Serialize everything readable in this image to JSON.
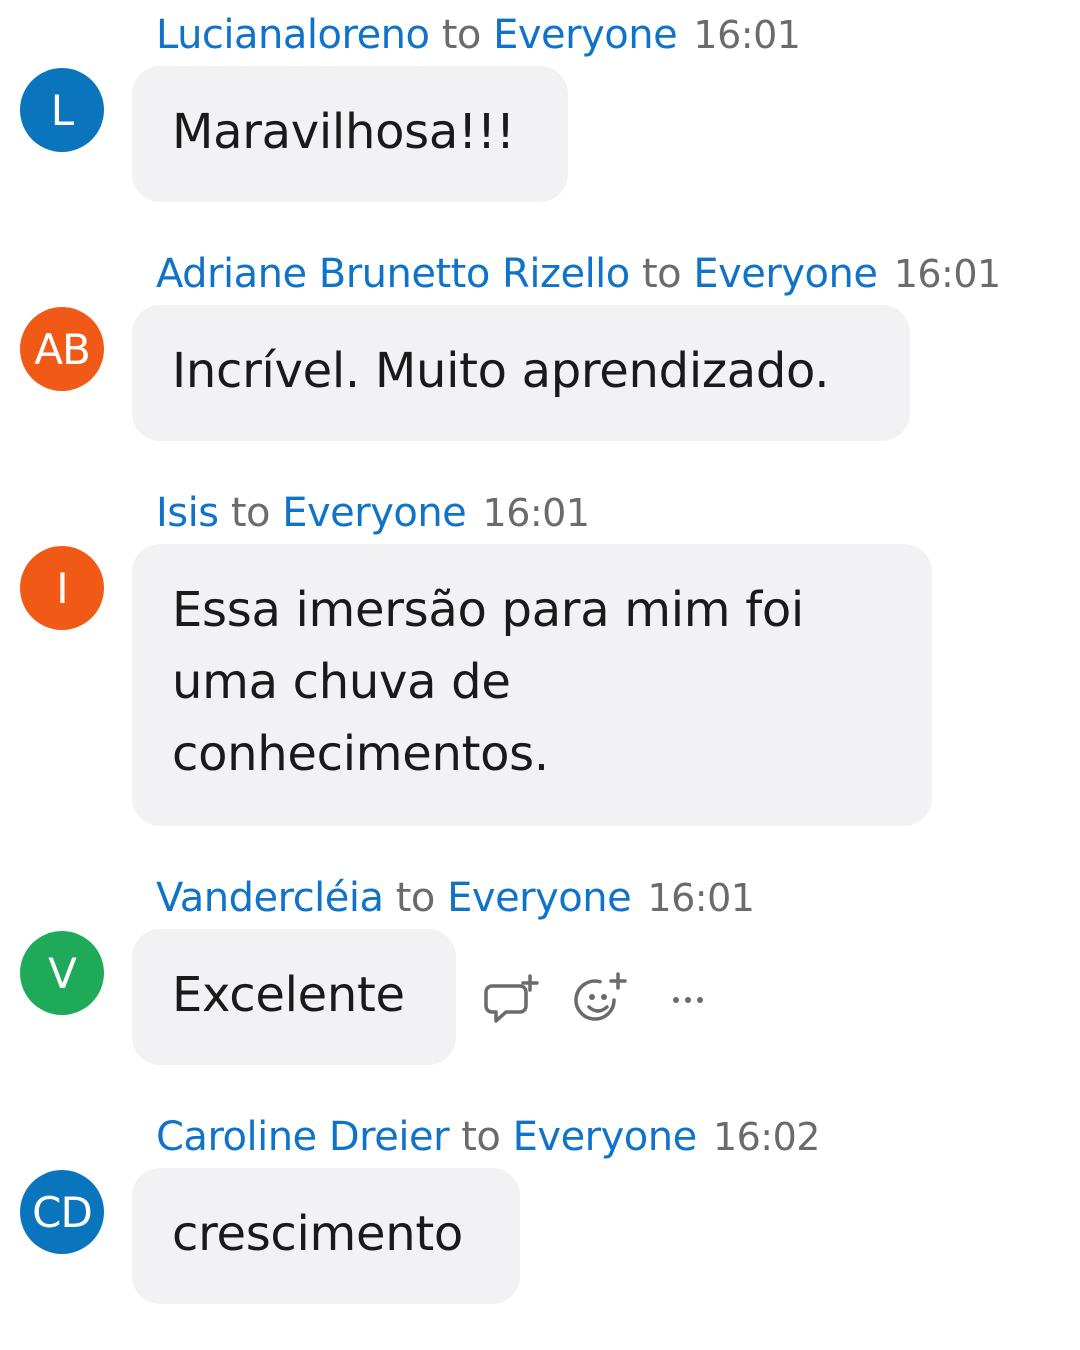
{
  "recipient": "Everyone",
  "to_word": "to",
  "messages": [
    {
      "sender": "Lucianaloreno",
      "time": "16:01",
      "initials": "L",
      "avatar_color": "#0a74bd",
      "text": "Maravilhosa!!!"
    },
    {
      "sender": "Adriane Brunetto Rizello",
      "time": "16:01",
      "initials": "AB",
      "avatar_color": "#f05a16",
      "text": "Incrível. Muito aprendizado."
    },
    {
      "sender": "Isis",
      "time": "16:01",
      "initials": "I",
      "avatar_color": "#f05a16",
      "text": "Essa imersão para mim foi uma chuva de conhecimentos."
    },
    {
      "sender": "Vandercléia",
      "time": "16:01",
      "initials": "V",
      "avatar_color": "#1faa5a",
      "text": "Excelente"
    },
    {
      "sender": "Caroline Dreier",
      "time": "16:02",
      "initials": "CD",
      "avatar_color": "#0a74bd",
      "text": "crescimento"
    }
  ],
  "hover_actions": {
    "icons": [
      "reply-icon",
      "add-reaction-icon",
      "more-options-icon"
    ],
    "more_label": "···"
  }
}
